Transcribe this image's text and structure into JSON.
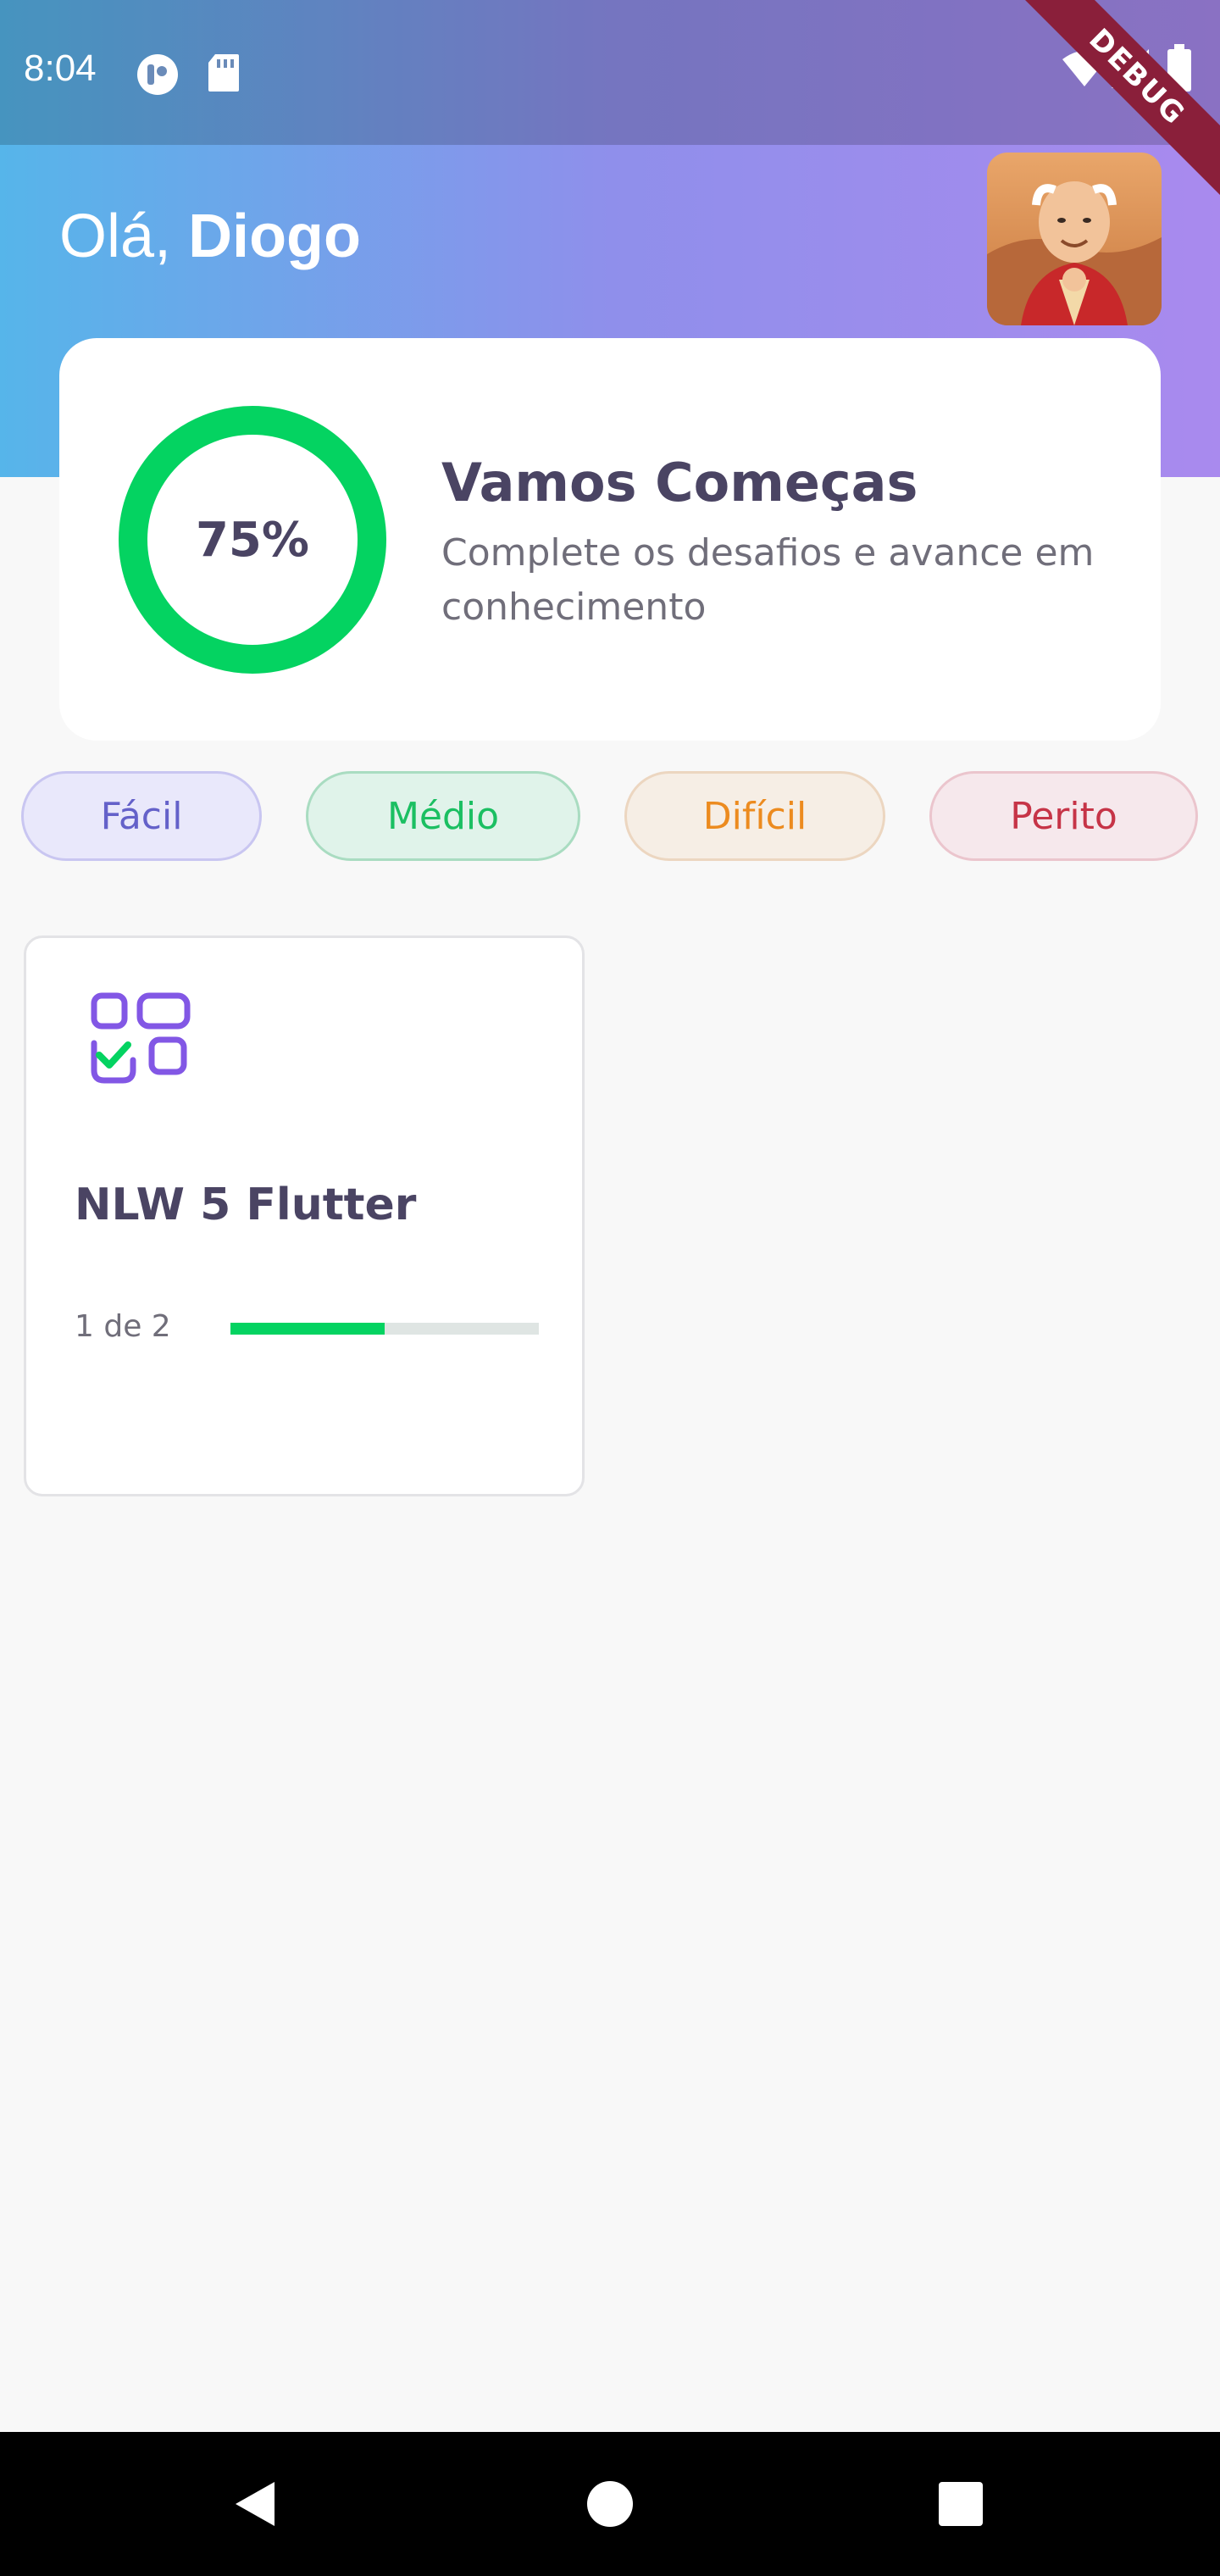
{
  "status_bar": {
    "time": "8:04",
    "icons": [
      "app-notification-icon",
      "sd-card-icon",
      "wifi-icon",
      "cell-signal-icon",
      "battery-icon"
    ]
  },
  "debug_banner": "DEBUG",
  "header": {
    "greeting_prefix": "Olá, ",
    "user_name": "Diogo",
    "avatar": "user-avatar-image"
  },
  "score_card": {
    "percent_label": "75%",
    "percent_value": 0.75,
    "title": "Vamos Começas",
    "subtitle": "Complete os desafios e avance em conhecimento"
  },
  "levels": [
    {
      "label": "Fácil",
      "text_color": "#6461c9",
      "bg": "#e9e8fb",
      "border": "#c9c6f1"
    },
    {
      "label": "Médio",
      "text_color": "#1bbf62",
      "bg": "#e0f3ea",
      "border": "#a9dcc1"
    },
    {
      "label": "Difícil",
      "text_color": "#ec8b1f",
      "bg": "#f6eee5",
      "border": "#ecd6c0"
    },
    {
      "label": "Perito",
      "text_color": "#c63447",
      "bg": "#f6e8ec",
      "border": "#ebc5cd"
    }
  ],
  "quizzes": [
    {
      "icon": "data-checklist-icon",
      "title": "NLW 5 Flutter",
      "progress_label": "1 de 2",
      "progress_value": 0.5
    }
  ],
  "colors": {
    "accent_green": "#04d361",
    "accent_purple": "#8257e5",
    "title_text": "#4a4463",
    "gradient_start": "#56b5ea",
    "gradient_end": "#a98aee"
  },
  "nav_bar": {
    "icons": [
      "back-icon",
      "home-icon",
      "recents-icon"
    ]
  }
}
